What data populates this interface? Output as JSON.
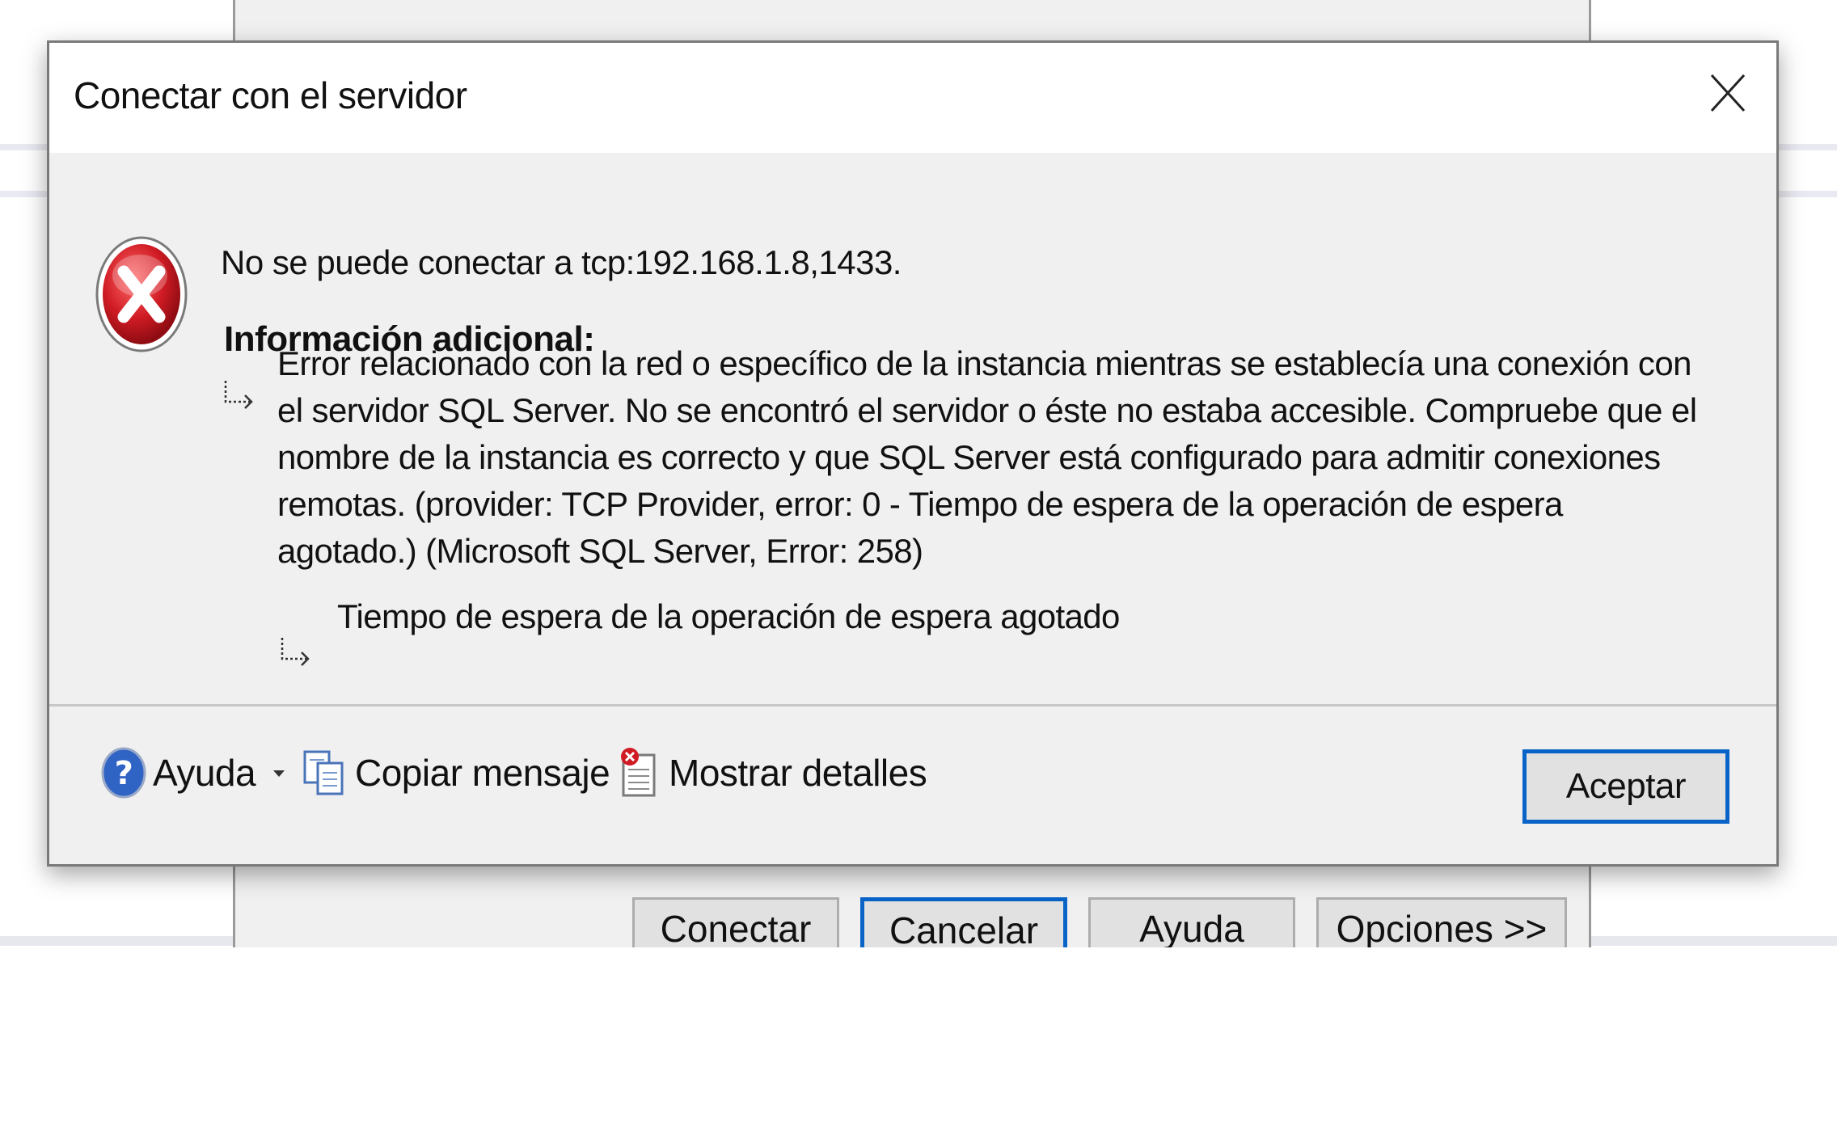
{
  "dialog": {
    "title": "Conectar con el servidor",
    "message": "No se puede conectar a tcp:192.168.1.8,1433.",
    "info_heading": "Información adicional:",
    "detail": "Error relacionado con la red o específico de la instancia mientras se establecía una conexión con el servidor SQL Server. No se encontró el servidor o éste no estaba accesible. Compruebe que el nombre de la instancia es correcto y que SQL Server está configurado para admitir conexiones remotas. (provider: TCP Provider, error: 0 - Tiempo de espera de la operación de espera agotado.) (Microsoft SQL Server, Error: 258)",
    "inner_detail": "Tiempo de espera de la operación de espera agotado",
    "footer": {
      "help_label": "Ayuda",
      "copy_label": "Copiar mensaje",
      "details_label": "Mostrar detalles",
      "ok_label": "Aceptar"
    }
  },
  "background_window": {
    "buttons": [
      "Conectar",
      "Cancelar",
      "Ayuda",
      "Opciones >>"
    ]
  },
  "colors": {
    "accent": "#0a64c8",
    "error_red": "#c8141e",
    "dialog_bg": "#f0f0f0"
  }
}
